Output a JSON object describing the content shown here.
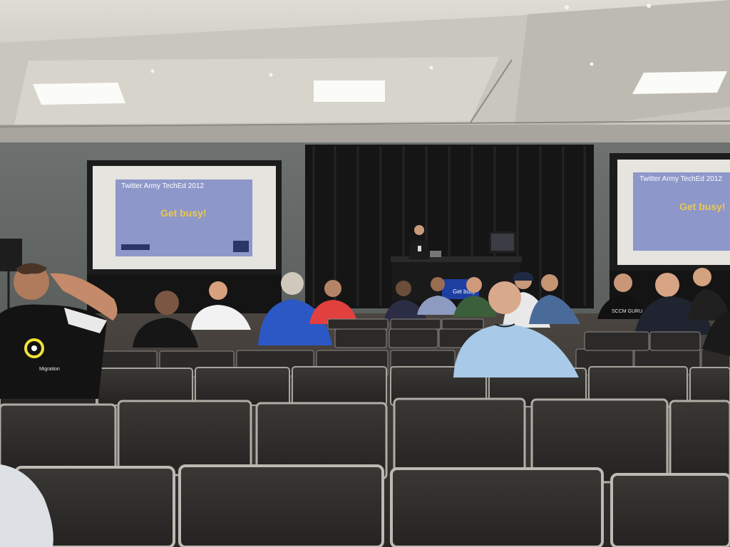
{
  "screens": {
    "left": {
      "title": "Twitter Army TechEd 2012",
      "body": "Get busy!"
    },
    "right": {
      "title": "Twitter Army TechEd 2012",
      "body": "Get busy!"
    },
    "podium_monitor": {
      "body": "Get busy"
    }
  },
  "shirt_text": {
    "sccm_shirt": "SCCM GURU",
    "migration_shirt": "Migration"
  },
  "colors": {
    "screen_frame": "#1c1c1c",
    "screen_background": "#e6e4de",
    "slide_panel": "#8e97c9",
    "slide_text": "#e8c850",
    "curtain": "#141414",
    "chair": "#2e2c2a"
  }
}
